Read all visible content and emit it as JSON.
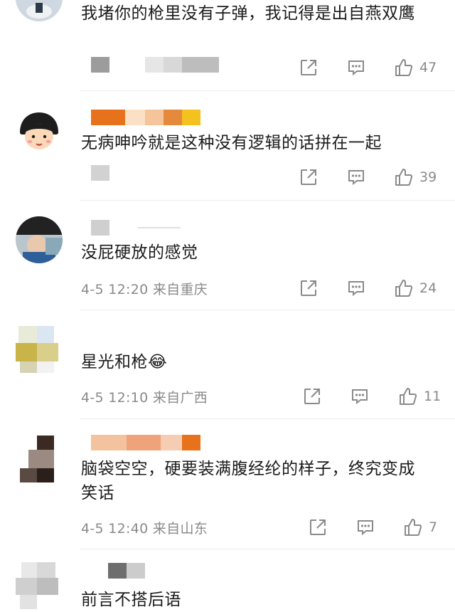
{
  "comments": [
    {
      "text": "我堵你的枪里没有子弹，我记得是出自燕双鹰",
      "meta": "",
      "likes": "47",
      "avatar_icon": "avatar-user-1"
    },
    {
      "text": "无病呻吟就是这种没有逻辑的话拼在一起",
      "meta": "",
      "likes": "39",
      "avatar_icon": "avatar-cartoon-girl"
    },
    {
      "text": "没屁硬放的感觉",
      "meta": "4-5 12:20 来自重庆",
      "likes": "24",
      "avatar_icon": "avatar-user-3"
    },
    {
      "text": "星光和枪😂",
      "meta": "4-5 12:10 来自广西",
      "likes": "11",
      "avatar_icon": "avatar-user-4"
    },
    {
      "text": "脑袋空空，硬要装满腹经纶的样子，终究变成笑话",
      "meta": "4-5 12:40 来自山东",
      "likes": "7",
      "avatar_icon": "avatar-user-5"
    },
    {
      "text": "前言不搭后语",
      "meta": "",
      "likes": "",
      "avatar_icon": "avatar-user-6"
    }
  ],
  "icons": {
    "share": "share-icon",
    "reply": "comment-icon",
    "like": "thumbs-up-icon"
  },
  "colors": {
    "text": "#1b1b1b",
    "meta": "#8a8a8a",
    "icon": "#8a8a8a",
    "divider": "#ececec",
    "accent_orange": "#e8721c"
  }
}
